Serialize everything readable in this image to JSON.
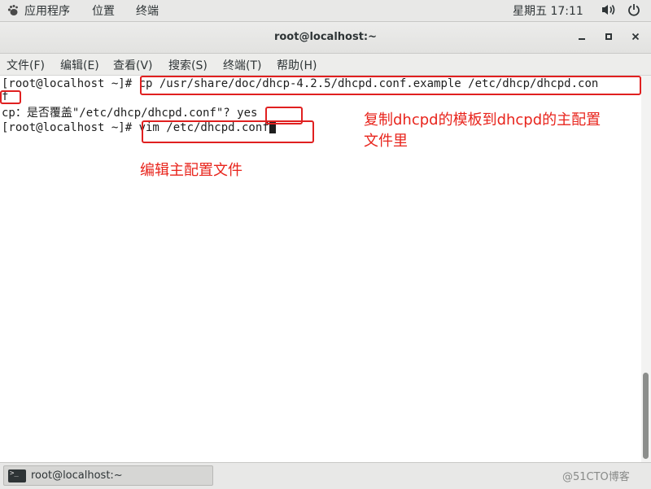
{
  "top_panel": {
    "apps_label": "应用程序",
    "places_label": "位置",
    "terminal_label": "终端",
    "clock": "星期五 17:11"
  },
  "window": {
    "title": "root@localhost:~"
  },
  "menubar": {
    "items": [
      "文件(F)",
      "编辑(E)",
      "查看(V)",
      "搜索(S)",
      "终端(T)",
      "帮助(H)"
    ]
  },
  "terminal": {
    "lines": [
      "[root@localhost ~]# cp /usr/share/doc/dhcp-4.2.5/dhcpd.conf.example /etc/dhcp/dhcpd.con",
      "f",
      "cp：是否覆盖\"/etc/dhcp/dhcpd.conf\"? yes",
      "[root@localhost ~]# vim /etc/dhcpd.conf"
    ]
  },
  "annotations": {
    "copy_note_line1": "复制dhcpd的模板到dhcpd的主配置",
    "copy_note_line2": "文件里",
    "edit_note": "编辑主配置文件"
  },
  "taskbar": {
    "item_label": "root@localhost:~",
    "watermark": "@51CTO博客"
  },
  "colors": {
    "annotation_red": "#e8241c",
    "panel_bg": "#e8e8e7",
    "terminal_bg": "#ffffff"
  }
}
